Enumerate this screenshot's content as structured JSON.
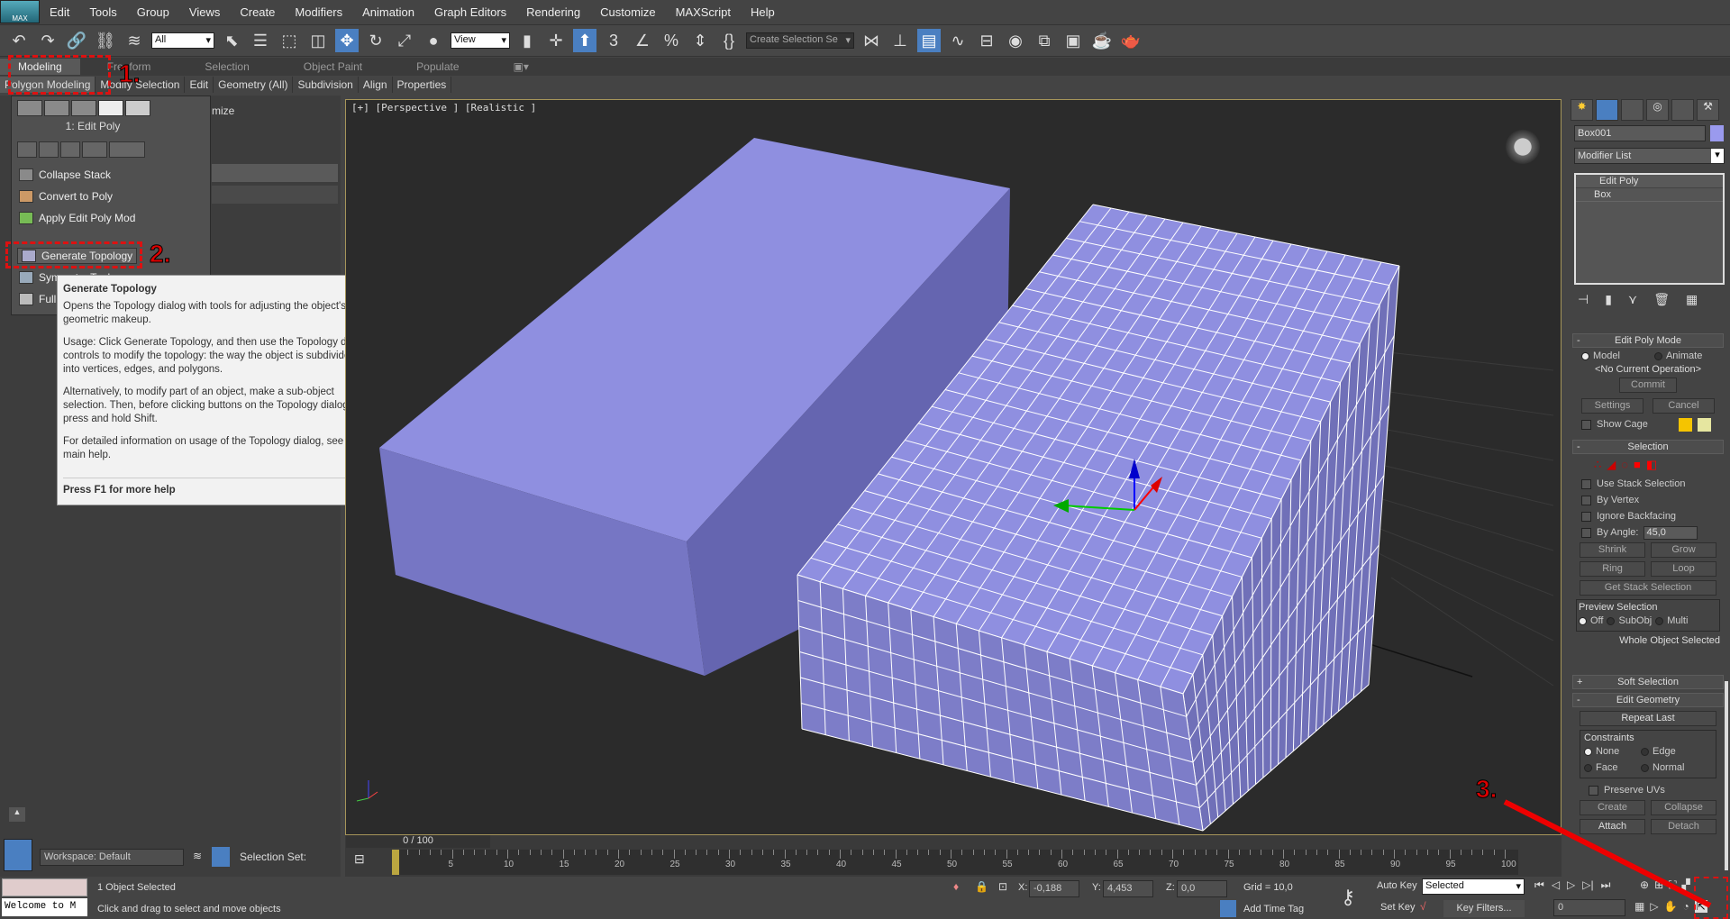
{
  "app": {
    "logo": "MAX"
  },
  "menu": [
    "Edit",
    "Tools",
    "Group",
    "Views",
    "Create",
    "Modifiers",
    "Animation",
    "Graph Editors",
    "Rendering",
    "Customize",
    "MAXScript",
    "Help"
  ],
  "toolbar": {
    "filter": "All",
    "ref_coord": "View",
    "selection_set_placeholder": "Create Selection Se",
    "snap_3": "3",
    "snap_pct": "%"
  },
  "ribbon_tabs": [
    "Modeling",
    "Freeform",
    "Selection",
    "Object Paint",
    "Populate"
  ],
  "ribbon_groups": [
    "Polygon Modeling",
    "Modify Selection",
    "Edit",
    "Geometry (All)",
    "Subdivision",
    "Align",
    "Properties"
  ],
  "flyout": {
    "stack_label": "1: Edit Poly",
    "items": [
      "Collapse Stack",
      "Convert to Poly",
      "Apply Edit Poly Mod",
      "Generate Topology",
      "Symmetry Tools",
      "Full Interactivity"
    ],
    "partial": "mize"
  },
  "tooltip": {
    "title": "Generate Topology",
    "paragraphs": [
      "Opens the Topology dialog with tools for adjusting the object's geometric makeup.",
      "Usage: Click Generate Topology, and then use the Topology dialog controls to modify the topology: the way the object is subdivided into vertices, edges, and polygons.",
      "Alternatively, to modify part of an object, make a sub-object selection. Then, before clicking buttons on the Topology dialog, press and hold Shift.",
      "For detailed information on usage of the Topology dialog, see the main help."
    ],
    "footer": "Press F1 for more help"
  },
  "annotations": {
    "step1": "1.",
    "step2": "2.",
    "step3": "3."
  },
  "viewport": {
    "label": "[+] [Perspective ] [Realistic ]",
    "object_color": "#8f8fe0",
    "grid": {
      "top": [
        17,
        22
      ],
      "front": [
        17,
        6
      ],
      "side": [
        22,
        6
      ]
    }
  },
  "command_panel": {
    "object_name": "Box001",
    "object_color": "#9a9aee",
    "modifier_list": "Modifier List",
    "stack": [
      "Edit Poly",
      "Box"
    ],
    "edit_poly_mode": {
      "title": "Edit Poly Mode",
      "model": "Model",
      "animate": "Animate",
      "operation": "<No Current Operation>",
      "commit": "Commit",
      "settings": "Settings",
      "cancel": "Cancel",
      "show_cage": "Show Cage",
      "cage_colors": [
        "#f5c400",
        "#e6e6a0"
      ]
    },
    "selection": {
      "title": "Selection",
      "use_stack": "Use Stack Selection",
      "by_vertex": "By Vertex",
      "ignore_backfacing": "Ignore Backfacing",
      "by_angle": "By Angle:",
      "angle": "45,0",
      "shrink": "Shrink",
      "grow": "Grow",
      "ring": "Ring",
      "loop": "Loop",
      "get_stack": "Get Stack Selection",
      "preview": "Preview Selection",
      "off": "Off",
      "subobj": "SubObj",
      "multi": "Multi",
      "status": "Whole Object Selected"
    },
    "soft_selection": "Soft Selection",
    "edit_geometry": {
      "title": "Edit Geometry",
      "repeat_last": "Repeat Last",
      "constraints": "Constraints",
      "none": "None",
      "edge": "Edge",
      "face": "Face",
      "normal": "Normal",
      "preserve_uvs": "Preserve UVs",
      "create": "Create",
      "collapse": "Collapse",
      "attach": "Attach",
      "detach": "Detach"
    }
  },
  "timeline": {
    "frame": "0 / 100",
    "ticks": [
      "0",
      "5",
      "10",
      "15",
      "20",
      "25",
      "30",
      "35",
      "40",
      "45",
      "50",
      "55",
      "60",
      "65",
      "70",
      "75",
      "80",
      "85",
      "90",
      "95",
      "100"
    ]
  },
  "left_bottom": {
    "workspace": "Workspace: Default",
    "selection_set": "Selection Set:"
  },
  "status": {
    "listener": "Welcome to M",
    "selected": "1 Object Selected",
    "prompt": "Click and drag to select and move objects",
    "x_label": "X:",
    "x": "-0,188",
    "y_label": "Y:",
    "y": "4,453",
    "z_label": "Z:",
    "z": "0,0",
    "grid": "Grid = 10,0",
    "add_time_tag": "Add Time Tag",
    "auto_key": "Auto Key",
    "set_key": "Set Key",
    "key_mode": "Selected",
    "key_filters": "Key Filters...",
    "current_frame": "0"
  }
}
